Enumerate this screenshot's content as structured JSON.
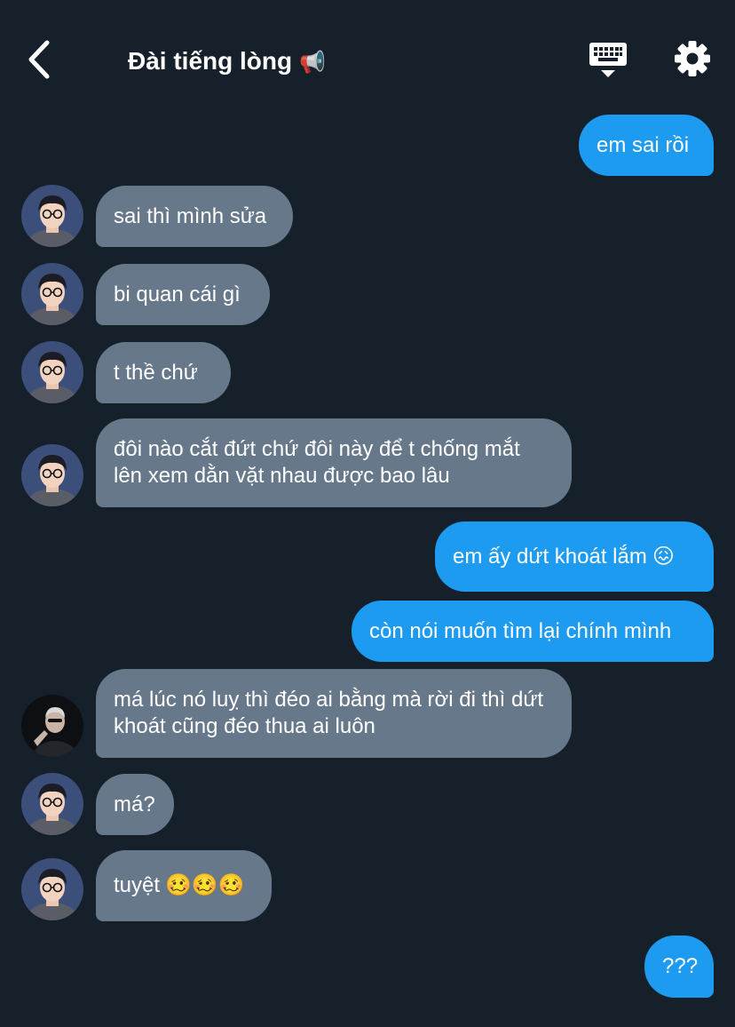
{
  "header": {
    "back_icon": "chevron-left-icon",
    "title": "Đài tiếng lòng",
    "title_emoji": "📢",
    "keyboard_icon": "keyboard-icon",
    "settings_icon": "gear-icon"
  },
  "colors": {
    "background": "#15202b",
    "outgoing_bubble": "#1d9bf0",
    "incoming_bubble": "#66788a"
  },
  "messages": [
    {
      "direction": "outgoing",
      "text": "em sai rồi"
    },
    {
      "direction": "incoming",
      "text": "sai thì mình sửa",
      "avatar": "avatar-glasses"
    },
    {
      "direction": "incoming",
      "text": "bi quan cái gì",
      "avatar": "avatar-glasses"
    },
    {
      "direction": "incoming",
      "text": "t thề chứ",
      "avatar": "avatar-glasses"
    },
    {
      "direction": "incoming",
      "text": "đôi nào cắt đứt chứ đôi này để t chống mắt lên xem dằn vặt nhau được bao lâu",
      "avatar": "avatar-glasses"
    },
    {
      "direction": "outgoing",
      "text": "em ấy dứt khoát lắm",
      "emoji": "😖"
    },
    {
      "direction": "outgoing",
      "text": "còn nói muốn tìm lại chính mình"
    },
    {
      "direction": "incoming",
      "text": "má lúc nó luỵ thì đéo ai bằng mà rời đi thì dứt khoát cũng đéo thua ai luôn",
      "avatar": "avatar-dark"
    },
    {
      "direction": "incoming",
      "text": "má?",
      "avatar": "avatar-glasses"
    },
    {
      "direction": "incoming",
      "text": "tuyệt",
      "emoji": "🥴🥴🥴",
      "avatar": "avatar-glasses"
    },
    {
      "direction": "outgoing",
      "text": "???"
    }
  ]
}
